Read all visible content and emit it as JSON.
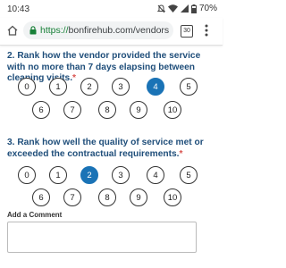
{
  "status_bar": {
    "time": "10:43",
    "battery": "70%"
  },
  "browser": {
    "url_scheme": "https://",
    "url_rest": "bonfirehub.com/vendors",
    "tab_count": "30"
  },
  "questions": [
    {
      "title": "2. Rank how the vendor provided the service with no more than 7 days elapsing between cleaning visits.",
      "required_marker": "*",
      "options": [
        "0",
        "1",
        "2",
        "3",
        "4",
        "5",
        "6",
        "7",
        "8",
        "9",
        "10"
      ],
      "selected": "4"
    },
    {
      "title": "3. Rank how well the quality of service met or exceeded the contractual requirements.",
      "required_marker": "*",
      "options": [
        "0",
        "1",
        "2",
        "3",
        "4",
        "5",
        "6",
        "7",
        "8",
        "9",
        "10"
      ],
      "selected": "2"
    }
  ],
  "comment": {
    "label": "Add a Comment",
    "value": ""
  },
  "colors": {
    "question_title": "#1f4e7a",
    "required": "#d9534f",
    "selected_fill": "#1a73b6",
    "url_scheme": "#188038"
  }
}
